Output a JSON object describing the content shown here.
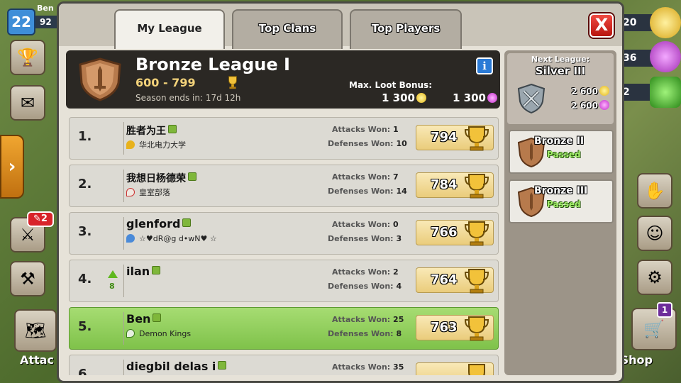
{
  "hud": {
    "player_level": "22",
    "player_name": "Ben",
    "exp_partial": "92",
    "attack_badge": "2",
    "attack_label": "Attac",
    "gold_partial": "20",
    "elixir_partial": "36",
    "gems_partial": "2",
    "shop_badge": "1",
    "shop_label": "Shop"
  },
  "tabs": [
    {
      "label": "My League",
      "active": true
    },
    {
      "label": "Top Clans",
      "active": false
    },
    {
      "label": "Top Players",
      "active": false
    }
  ],
  "close_label": "X",
  "league": {
    "title": "Bronze League I",
    "range": "600 - 799",
    "season": "Season ends in: 17d 12h",
    "info_label": "i",
    "max_loot_label": "Max. Loot Bonus:",
    "loot_gold": "1 300",
    "loot_elixir": "1 300"
  },
  "players": [
    {
      "rank": "1.",
      "name": "胜者为王",
      "clan": "华北电力大学",
      "attacks": "1",
      "defenses": "10",
      "trophies": "794"
    },
    {
      "rank": "2.",
      "name": "我想日杨德荣",
      "clan": "皇室部落",
      "attacks": "7",
      "defenses": "14",
      "trophies": "784"
    },
    {
      "rank": "3.",
      "name": "glenford",
      "clan": "☆♥dR@g d•wN♥ ☆",
      "attacks": "0",
      "defenses": "3",
      "trophies": "766"
    },
    {
      "rank": "4.",
      "name": "ilan",
      "clan": "",
      "change": "8",
      "attacks": "2",
      "defenses": "4",
      "trophies": "764"
    },
    {
      "rank": "5.",
      "name": "Ben",
      "clan": "Demon Kings",
      "attacks": "25",
      "defenses": "8",
      "trophies": "763"
    },
    {
      "rank": "6.",
      "name": "diegbil delas i",
      "clan": "",
      "attacks": "35",
      "defenses": "",
      "trophies": ""
    }
  ],
  "labels": {
    "attacks_won": "Attacks Won:",
    "defenses_won": "Defenses Won:"
  },
  "next_league": {
    "label": "Next League:",
    "name": "Silver III",
    "gold": "2 600",
    "elixir": "2 600"
  },
  "past_leagues": [
    {
      "name": "Bronze II",
      "status": "Passed"
    },
    {
      "name": "Bronze III",
      "status": "Passed"
    }
  ],
  "colors": {
    "highlight_row": "#8fd05a",
    "close_button": "#d8232a",
    "info_button": "#2b7bd6"
  }
}
